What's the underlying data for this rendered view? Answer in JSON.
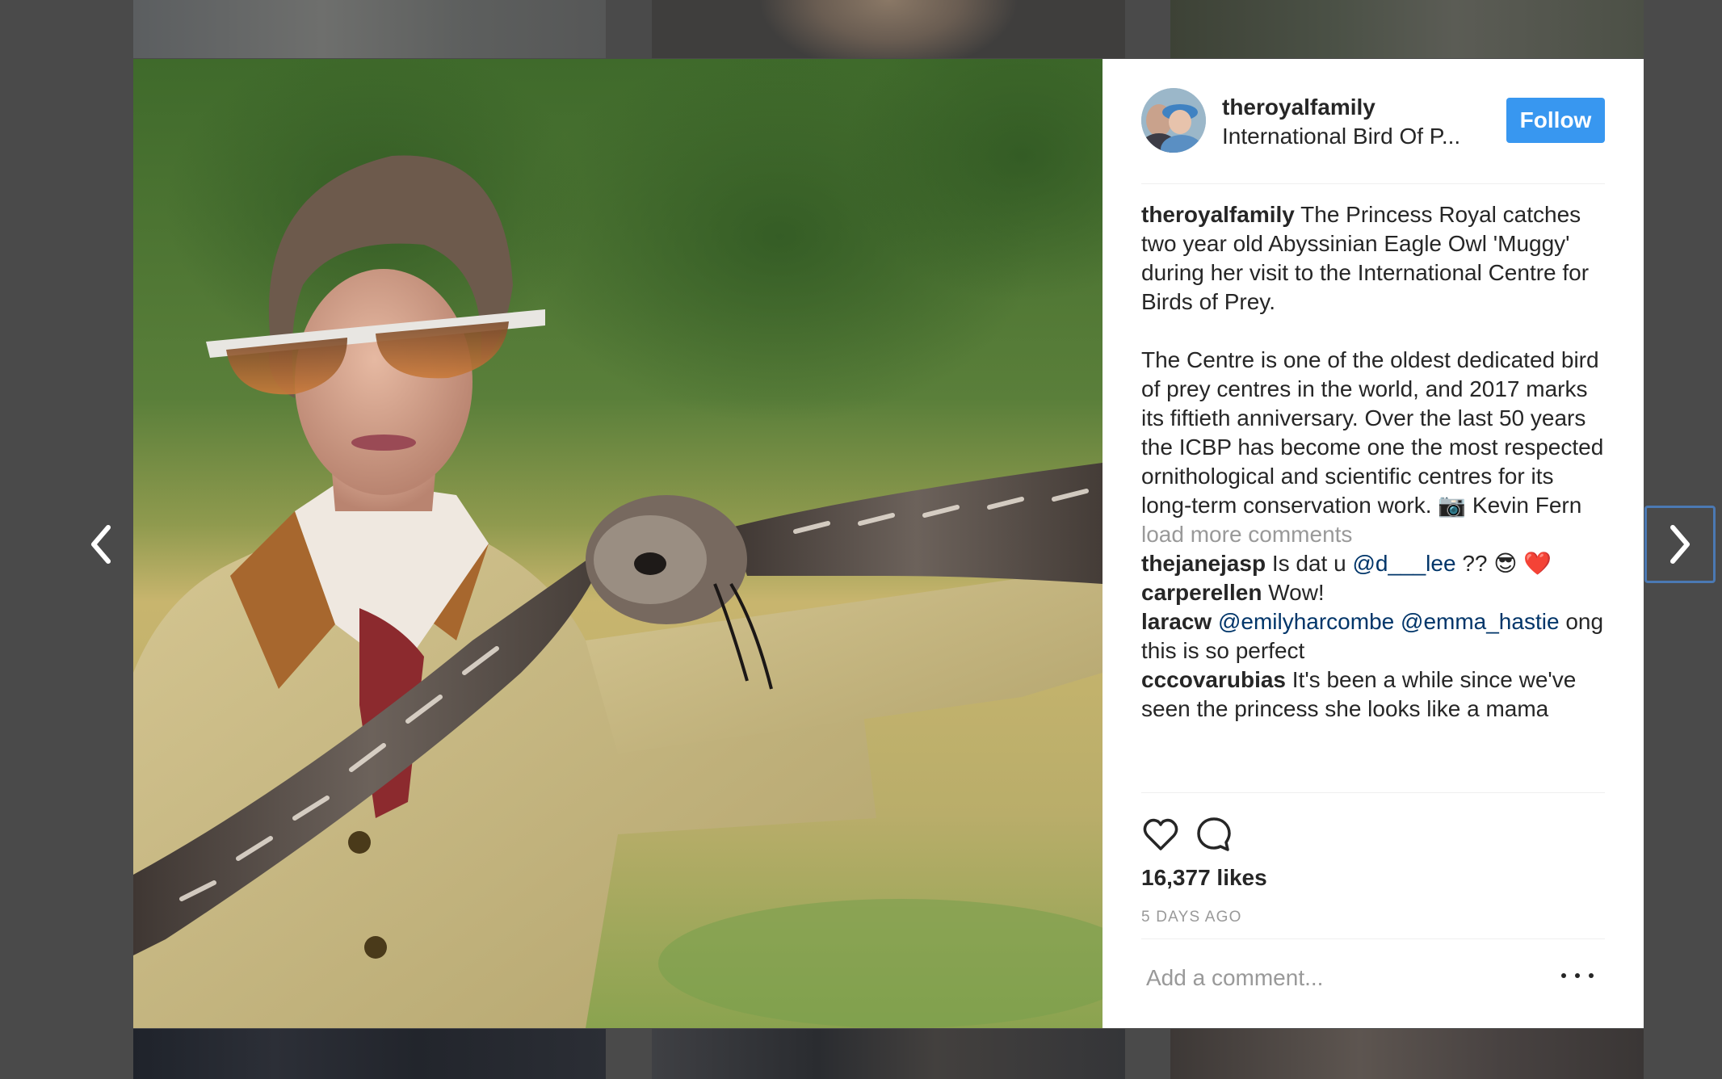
{
  "post": {
    "username": "theroyalfamily",
    "location": "International Bird Of P...",
    "follow_label": "Follow",
    "caption_handle": "theroyalfamily",
    "caption_text": "The Princess Royal catches two year old Abyssinian Eagle Owl 'Muggy' during her visit to the International Centre for Birds of Prey.\n\nThe Centre is one of the oldest dedicated bird of prey centres in the world, and 2017 marks its fiftieth anniversary. Over the last 50 years the ICBP has become one the most respected ornithological and scientific centres for its long-term conservation work. 📷 Kevin Fern",
    "load_more": "load more comments",
    "comments": [
      {
        "user": "thejanejasp",
        "pre": "Is dat u ",
        "mention1": "@d___lee",
        "post": " ?? 😎 ",
        "emoji": "❤️"
      },
      {
        "user": "carperellen",
        "text": "Wow!"
      },
      {
        "user": "laracw",
        "mention1": "@emilyharcombe",
        "mention2": "@emma_hastie",
        "text": "ong this is so perfect"
      },
      {
        "user": "cccovarubias",
        "text": "It's been a while since we've seen the princess she looks like a mama"
      }
    ],
    "likes": "16,377 likes",
    "time": "5 days ago",
    "comment_placeholder": "Add a comment..."
  },
  "icons": {
    "prev": "chevron-left-icon",
    "next": "chevron-right-icon",
    "like": "heart-outline-icon",
    "comment": "speech-bubble-icon",
    "more": "more-horizontal-icon"
  },
  "colors": {
    "follow_button": "#3897f0",
    "mention": "#003569",
    "secondary_text": "#999999",
    "overlay": "#4a4a4a"
  }
}
